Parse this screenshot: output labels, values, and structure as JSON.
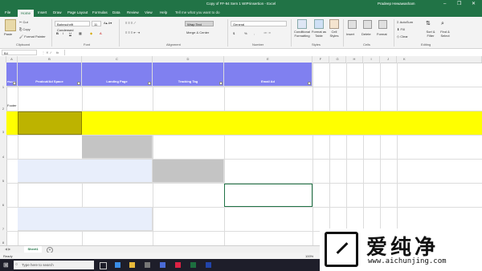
{
  "titlebar": {
    "title": "Copy of FF-94 Sem 1 WIPrinsertion - Excel",
    "user": "Pradeep Hewawasham",
    "minimize": "–",
    "restore": "❐",
    "close": "✕"
  },
  "tabs": [
    "File",
    "Home",
    "Insert",
    "Draw",
    "Page Layout",
    "Formulas",
    "Data",
    "Review",
    "View",
    "Help",
    "Tell me what you want to do"
  ],
  "ribbon": {
    "paste": "Paste",
    "cut": "Cut",
    "copy": "Copy",
    "format_painter": "Format Painter",
    "font_name": "Bahnschrift Condensed",
    "font_size": "11",
    "wrap_text": "Wrap Text",
    "merge_center": "Merge & Center",
    "number_format": "General",
    "currency": "$",
    "percent": "%",
    "comma": ",",
    "conditional": "Conditional Formatting",
    "format_table": "Format as Table",
    "cell_styles": "Cell Styles",
    "insert": "Insert",
    "delete": "Delete",
    "format": "Format",
    "autosum": "AutoSum",
    "fill": "Fill",
    "clear": "Clear",
    "sort_filter": "Sort & Filter",
    "find_select": "Find & Select",
    "groups": [
      "Clipboard",
      "Font",
      "Alignment",
      "Number",
      "Styles",
      "Cells",
      "Editing"
    ]
  },
  "formula_bar": {
    "name_box": "B4",
    "fx": "fx",
    "value": ""
  },
  "columns": [
    "A",
    "B",
    "C",
    "D",
    "E",
    "F",
    "G",
    "H",
    "I",
    "J",
    "K"
  ],
  "rows": [
    "1",
    "2",
    "3",
    "4",
    "5",
    "6",
    "7",
    "8"
  ],
  "headers": [
    "Prodcut/Ad Space",
    "Landing Page",
    "Tracking Tag",
    "Email Ad"
  ],
  "row_labels": {
    "a1": "Placeh",
    "a2": "Footer"
  },
  "sheet_tab": "Sheet1",
  "status": {
    "left": "Ready",
    "zoom": "100%"
  },
  "taskbar": {
    "search_placeholder": "Type here to search"
  },
  "watermark": {
    "brand": "爱纯净",
    "url": "www.aichunjing.com"
  },
  "colors": {
    "excel_green": "#217346",
    "header_purple": "#8080f0",
    "yellow": "#ffff00",
    "olive": "#bdb300",
    "gray": "#c4c4c4",
    "light_blue": "#e8eefb"
  }
}
